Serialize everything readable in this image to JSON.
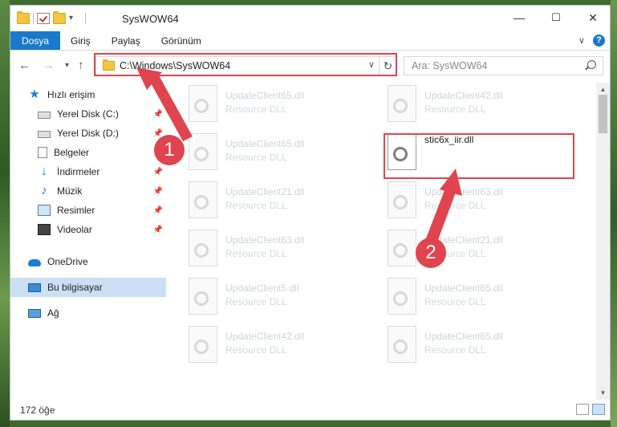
{
  "window": {
    "title": "SysWOW64",
    "controls": {
      "minimize": "—",
      "maximize": "☐",
      "close": "✕"
    }
  },
  "ribbon": {
    "tabs": [
      "Dosya",
      "Giriş",
      "Paylaş",
      "Görünüm"
    ],
    "active_tab": "Dosya",
    "expand_icon": "chevron-down-icon",
    "help_label": "?"
  },
  "nav": {
    "back_icon": "←",
    "forward_icon": "→",
    "history_icon": "▾",
    "up_icon": "↑",
    "address": "C:\\Windows\\SysWOW64",
    "dropdown_icon": "∨",
    "refresh_icon": "↻",
    "search_placeholder": "Ara: SysWOW64"
  },
  "sidebar": {
    "items": [
      {
        "label": "Hızlı erişim",
        "icon": "star-icon",
        "pinned": false
      },
      {
        "label": "Yerel Disk (C:)",
        "icon": "disk-icon",
        "pinned": true
      },
      {
        "label": "Yerel Disk (D:)",
        "icon": "disk-icon",
        "pinned": true
      },
      {
        "label": "Belgeler",
        "icon": "documents-icon",
        "pinned": true
      },
      {
        "label": "İndirmeler",
        "icon": "download-icon",
        "pinned": true
      },
      {
        "label": "Müzik",
        "icon": "music-icon",
        "pinned": true
      },
      {
        "label": "Resimler",
        "icon": "pictures-icon",
        "pinned": true
      },
      {
        "label": "Videolar",
        "icon": "videos-icon",
        "pinned": true
      },
      {
        "label": "OneDrive",
        "icon": "cloud-icon",
        "pinned": false
      },
      {
        "label": "Bu bilgisayar",
        "icon": "computer-icon",
        "pinned": false,
        "selected": true
      },
      {
        "label": "Ağ",
        "icon": "network-icon",
        "pinned": false
      }
    ]
  },
  "files": [
    {
      "name": "UpdateClient65.dll",
      "type": "Resource DLL"
    },
    {
      "name": "UpdateClient42.dll",
      "type": "Resource DLL"
    },
    {
      "name": "UpdateClient65.dll",
      "type": "Resource DLL"
    },
    {
      "name": "stic6x_iir.dll",
      "type": "",
      "selected": true
    },
    {
      "name": "UpdateClient21.dll",
      "type": "Resource DLL"
    },
    {
      "name": "UpdateClient63.dll",
      "type": "Resource DLL"
    },
    {
      "name": "UpdateClient63.dll",
      "type": "Resource DLL"
    },
    {
      "name": "UpdateClient21.dll",
      "type": "Resource DLL"
    },
    {
      "name": "UpdateClient5.dll",
      "type": "Resource DLL"
    },
    {
      "name": "UpdateClient65.dll",
      "type": "Resource DLL"
    },
    {
      "name": "UpdateClient42.dll",
      "type": "Resource DLL"
    },
    {
      "name": "UpdateClient65.dll",
      "type": "Resource DLL"
    }
  ],
  "status": {
    "item_count": "172 öğe"
  },
  "annotations": {
    "step1": "1",
    "step2": "2",
    "color": "#e0444e"
  },
  "colors": {
    "accent": "#1979ca",
    "selection": "#cce0f5"
  }
}
